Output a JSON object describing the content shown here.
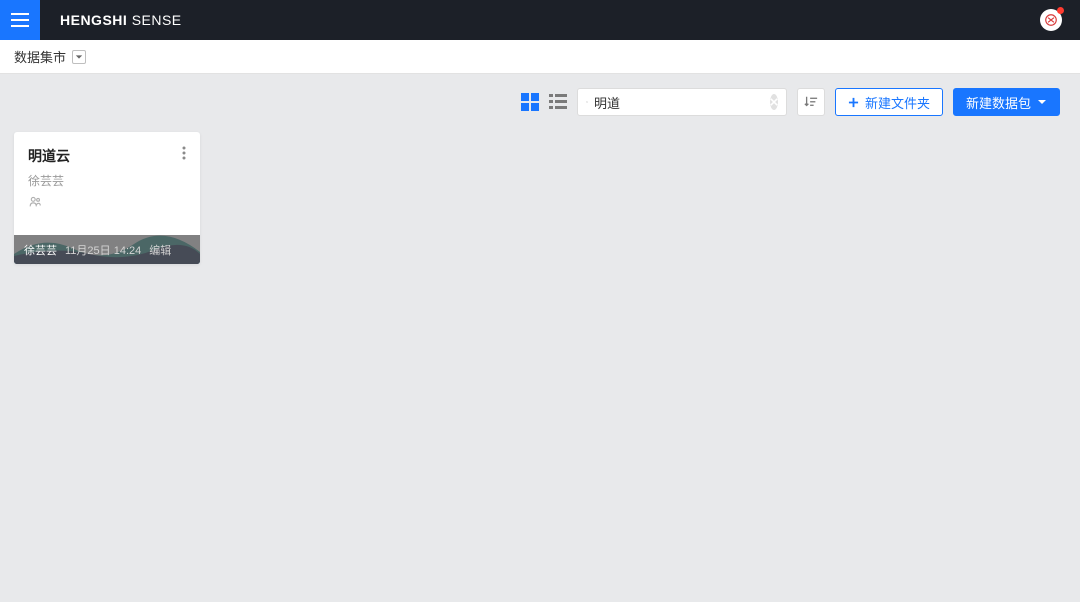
{
  "brand": {
    "bold": "HENGSHI",
    "light": "SENSE"
  },
  "breadcrumb": {
    "label": "数据集市"
  },
  "toolbar": {
    "search": {
      "value": "明道"
    },
    "new_folder": "新建文件夹",
    "new_package": "新建数据包"
  },
  "card": {
    "title": "明道云",
    "owner": "徐芸芸",
    "footer_user": "徐芸芸",
    "footer_date": "11月25日 14:24",
    "footer_action": "编辑"
  },
  "colors": {
    "accent": "#1976ff"
  }
}
